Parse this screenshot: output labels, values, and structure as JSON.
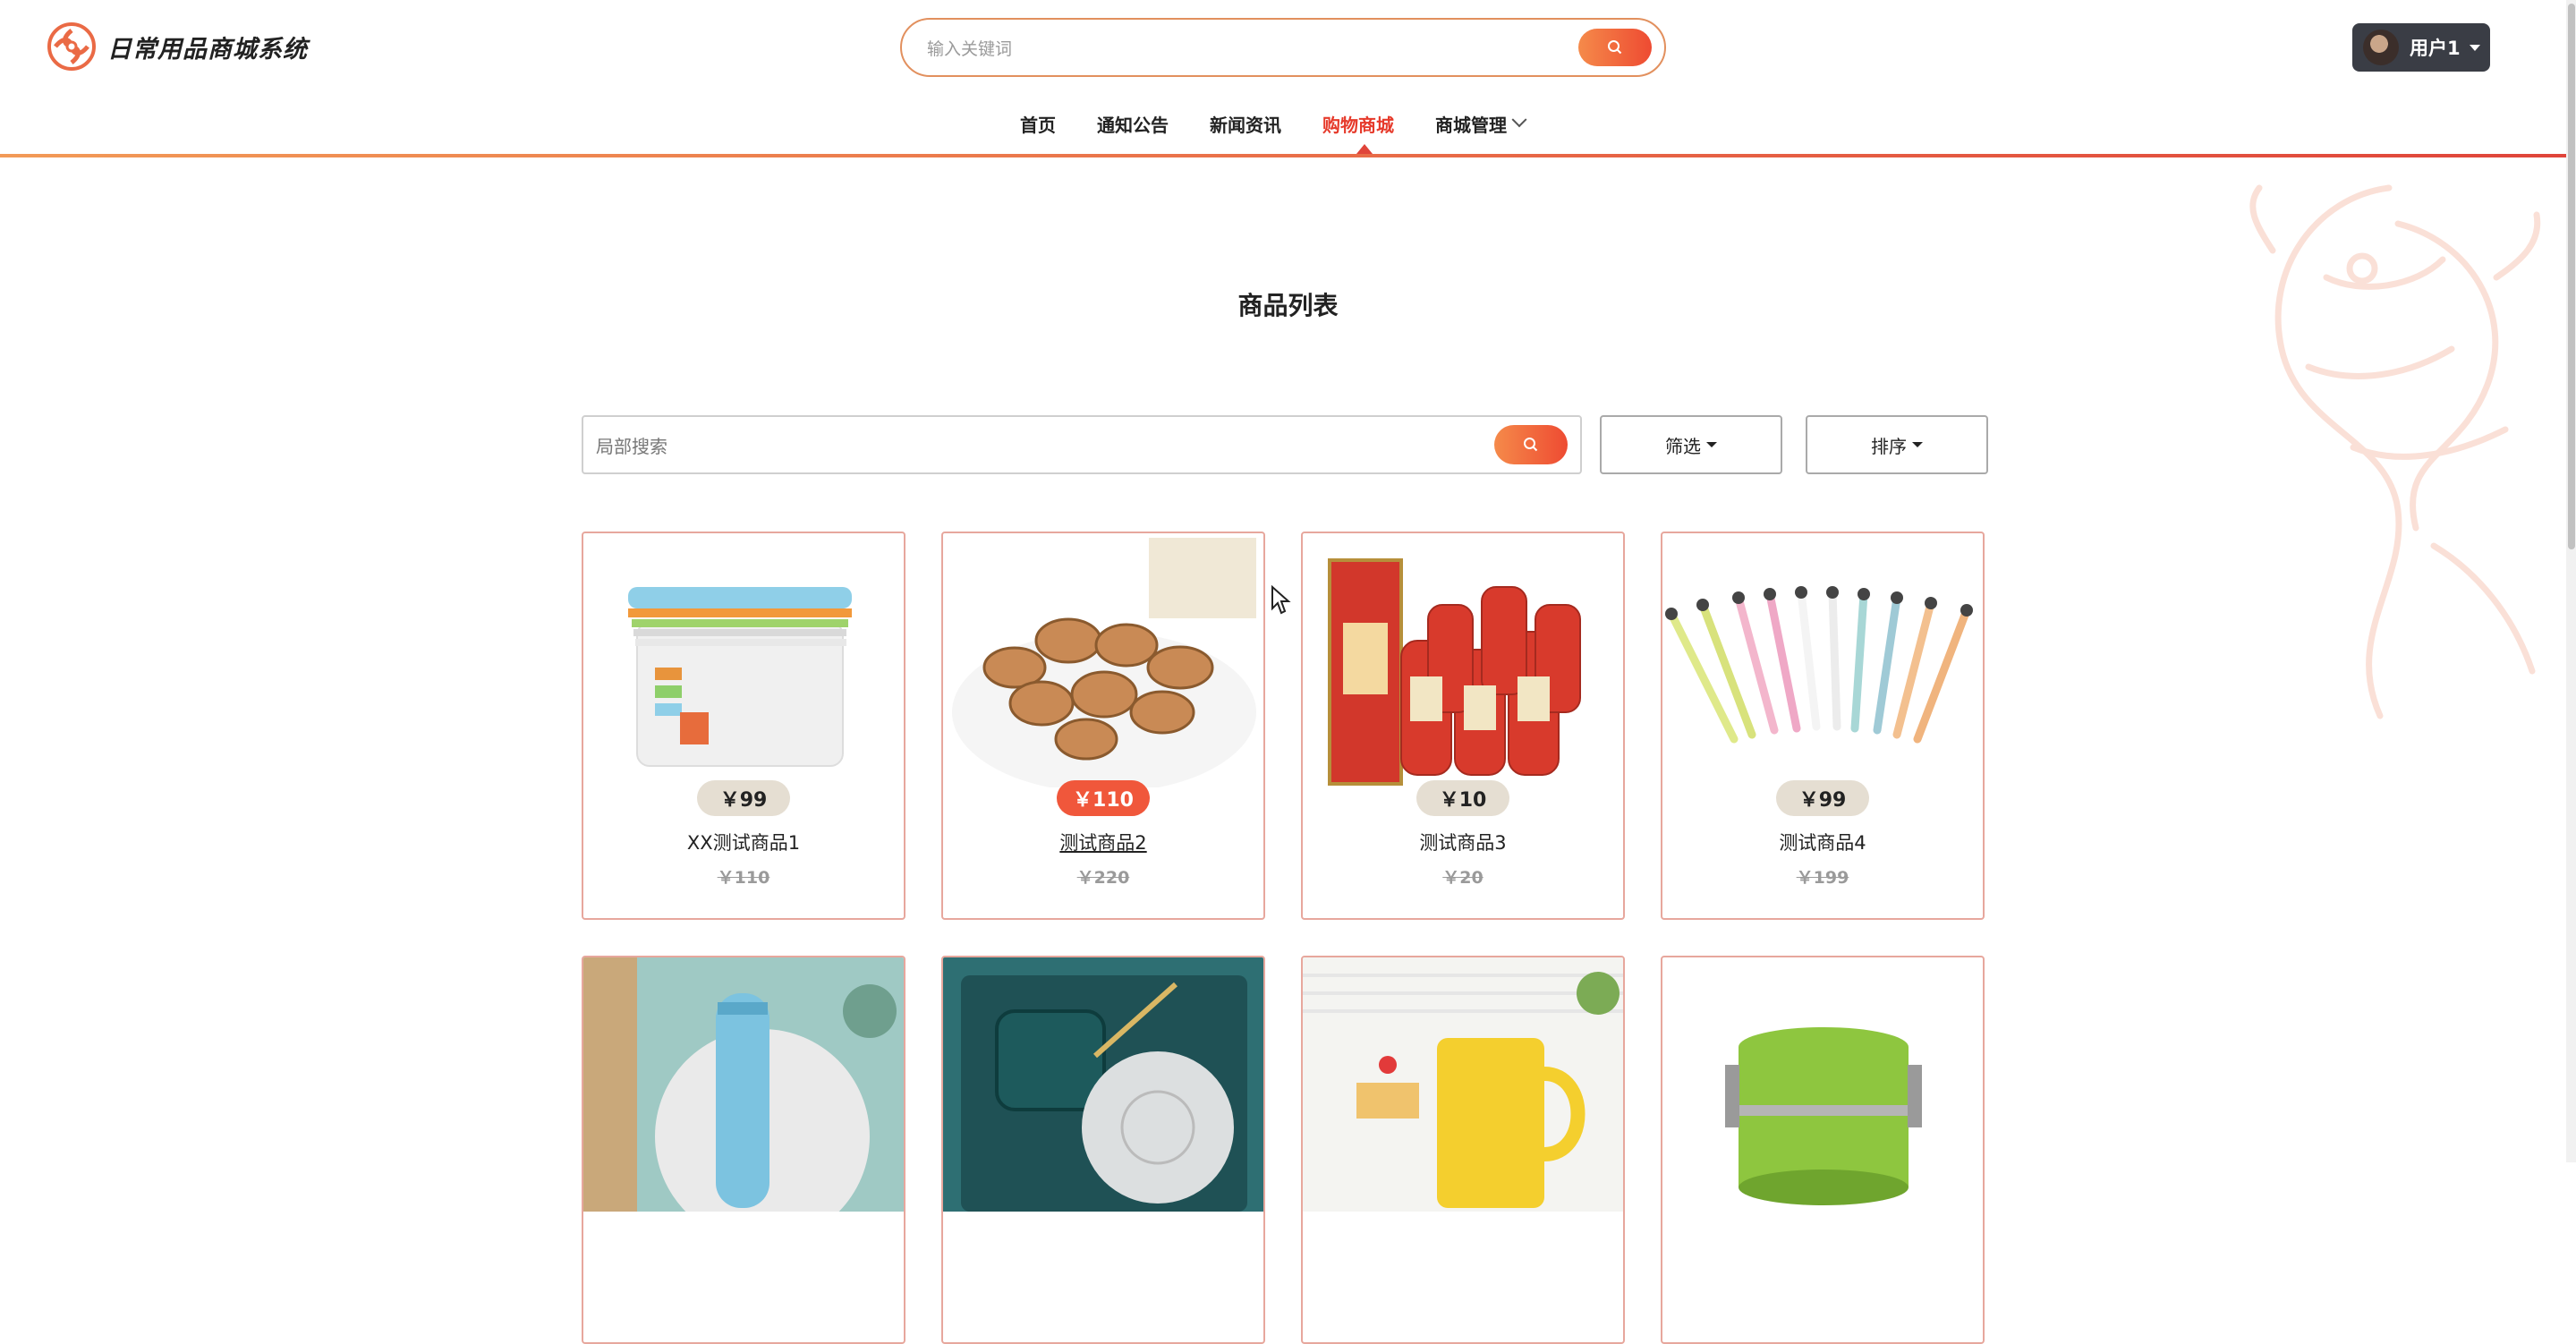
{
  "app": {
    "title": "日常用品商城系统",
    "search_placeholder": "输入关键词",
    "user_label": "用户1"
  },
  "nav": [
    {
      "label": "首页"
    },
    {
      "label": "通知公告"
    },
    {
      "label": "新闻资讯"
    },
    {
      "label": "购物商城",
      "active": true
    },
    {
      "label": "商城管理",
      "has_dropdown": true
    }
  ],
  "main": {
    "title": "商品列表",
    "local_search_placeholder": "局部搜索",
    "filter_label": "筛选",
    "sort_label": "排序"
  },
  "products": [
    {
      "name": "XX测试商品1",
      "price": "￥99",
      "old_price": "￥110",
      "image": "storage-boxes"
    },
    {
      "name": "测试商品2",
      "price": "￥110",
      "old_price": "￥220",
      "image": "almonds"
    },
    {
      "name": "测试商品3",
      "price": "￥10",
      "old_price": "￥20",
      "image": "liquor-bottles"
    },
    {
      "name": "测试商品4",
      "price": "￥99",
      "old_price": "￥199",
      "image": "toothbrushes"
    },
    {
      "name": "",
      "price": "",
      "old_price": "",
      "image": "blue-thermos"
    },
    {
      "name": "",
      "price": "",
      "old_price": "",
      "image": "mug-gift-set"
    },
    {
      "name": "",
      "price": "",
      "old_price": "",
      "image": "yellow-mug"
    },
    {
      "name": "",
      "price": "",
      "old_price": "",
      "image": "lunch-box"
    }
  ],
  "colors": {
    "accent": "#e63a2b",
    "accent_gradient_start": "#f58a4a",
    "price_badge": "#e5ded2",
    "price_badge_hot": "#f0573b",
    "card_border": "#e7a79d",
    "user_button": "#3a3d45"
  }
}
